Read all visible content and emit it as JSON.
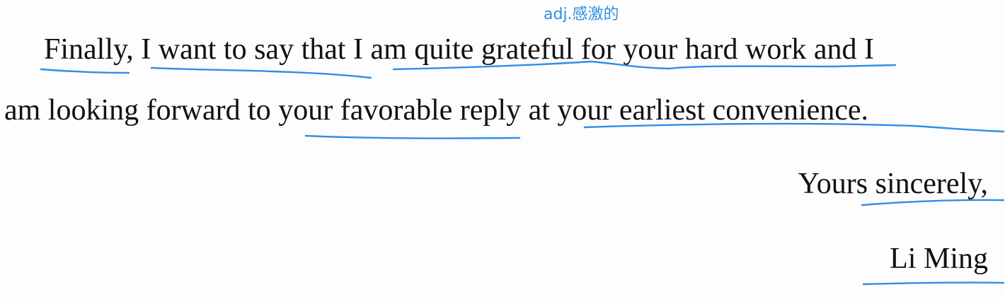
{
  "annotation": {
    "text": "adj.感激的",
    "color": "#2f8fe6"
  },
  "letter": {
    "line1": "Finally, I want to say that I am quite grateful for your hard work and I",
    "line2": "am looking forward to your favorable reply at your earliest convenience.",
    "closing": "Yours sincerely,",
    "signature": "Li Ming"
  },
  "ink": {
    "color": "#2f8fe6"
  }
}
